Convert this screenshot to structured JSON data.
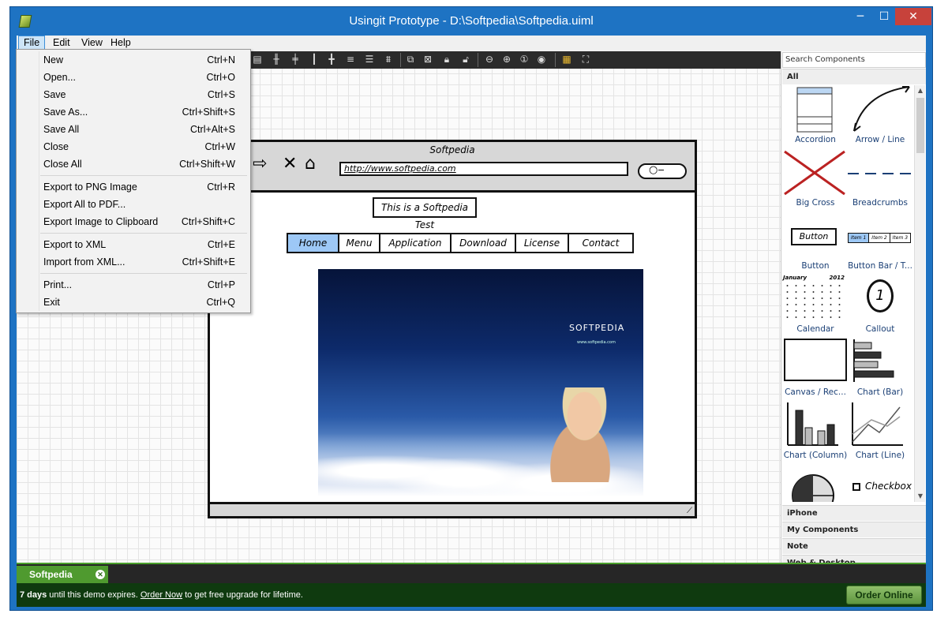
{
  "window": {
    "title": "Usingit Prototype - D:\\Softpedia\\Softpedia.uiml",
    "minimize": "─",
    "maximize": "☐",
    "close": "✕"
  },
  "menubar": [
    "File",
    "Edit",
    "View",
    "Help"
  ],
  "file_menu": {
    "groups": [
      [
        {
          "label": "New",
          "shortcut": "Ctrl+N"
        },
        {
          "label": "Open...",
          "shortcut": "Ctrl+O"
        },
        {
          "label": "Save",
          "shortcut": "Ctrl+S"
        },
        {
          "label": "Save As...",
          "shortcut": "Ctrl+Shift+S"
        },
        {
          "label": "Save All",
          "shortcut": "Ctrl+Alt+S"
        },
        {
          "label": "Close",
          "shortcut": "Ctrl+W"
        },
        {
          "label": "Close All",
          "shortcut": "Ctrl+Shift+W"
        }
      ],
      [
        {
          "label": "Export to PNG Image",
          "shortcut": "Ctrl+R"
        },
        {
          "label": "Export All to PDF...",
          "shortcut": ""
        },
        {
          "label": "Export Image to Clipboard",
          "shortcut": "Ctrl+Shift+C"
        }
      ],
      [
        {
          "label": "Export to XML",
          "shortcut": "Ctrl+E"
        },
        {
          "label": "Import from XML...",
          "shortcut": "Ctrl+Shift+E"
        }
      ],
      [
        {
          "label": "Print...",
          "shortcut": "Ctrl+P"
        },
        {
          "label": "Exit",
          "shortcut": "Ctrl+Q"
        }
      ]
    ]
  },
  "mockup": {
    "title": "Softpedia",
    "url": "http://www.softpedia.com",
    "label": "This is a Softpedia Test",
    "menu": [
      "Home",
      "Menu",
      "Application",
      "Download",
      "License",
      "Contact"
    ],
    "image_brand": "SOFTPEDIA",
    "image_sub": "www.softpedia.com"
  },
  "components": {
    "search_placeholder": "Search Components",
    "active_category": "All",
    "items": [
      "Accordion",
      "Arrow / Line",
      "Big Cross",
      "Breadcrumbs",
      "Button",
      "Button Bar / T...",
      "Calendar",
      "Callout",
      "Canvas / Rec...",
      "Chart (Bar)",
      "Chart (Column)",
      "Chart (Line)",
      "",
      "Checkbox"
    ],
    "thumb_texts": {
      "button": "Button",
      "button_bar": [
        "Item 1",
        "Item 2",
        "Item 3"
      ],
      "calendar_month": "January",
      "calendar_year": "2012",
      "callout": "1",
      "checkbox": "Checkbox"
    },
    "categories": [
      "iPhone",
      "My Components",
      "Note",
      "Web & Desktop"
    ]
  },
  "document_tab": "Softpedia",
  "status": {
    "days": "7 days",
    "text1": " until this demo expires. ",
    "link": "Order Now",
    "text2": " to get free upgrade for lifetime.",
    "button": "Order Online"
  },
  "colors": {
    "titlebar": "#1e73c3",
    "accent_green": "#4f9a2f",
    "menu_active": "#7cb9f3"
  }
}
